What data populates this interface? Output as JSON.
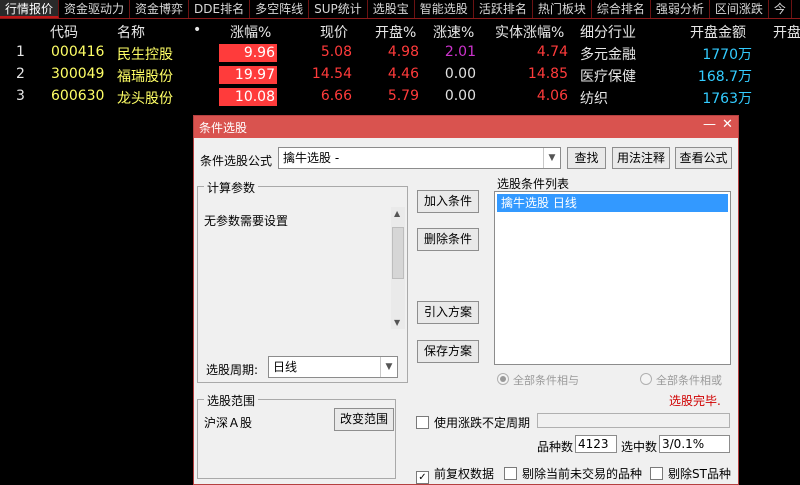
{
  "tabs": [
    "行情报价",
    "资金驱动力",
    "资金博弈",
    "DDE排名",
    "多空阵线",
    "SUP统计",
    "选股宝",
    "智能选股",
    "活跃排名",
    "热门板块",
    "综合排名",
    "强弱分析",
    "区间涨跌",
    "今"
  ],
  "table": {
    "headers": {
      "idx": "",
      "code": "代码",
      "name": "名称",
      "dot": "•",
      "pct": "涨幅%",
      "price": "现价",
      "open_pct": "开盘%",
      "speed": "涨速%",
      "body_pct": "实体涨幅%",
      "industry": "细分行业",
      "open_amt": "开盘金额",
      "open_more": "开盘"
    },
    "rows": [
      {
        "idx": "1",
        "code": "000416",
        "name": "民生控股",
        "pct": "9.96",
        "price": "5.08",
        "open_pct": "4.98",
        "speed": "2.01",
        "body_pct": "4.74",
        "industry": "多元金融",
        "open_amt": "1770万"
      },
      {
        "idx": "2",
        "code": "300049",
        "name": "福瑞股份",
        "pct": "19.97",
        "price": "14.54",
        "open_pct": "4.46",
        "speed": "0.00",
        "body_pct": "14.85",
        "industry": "医疗保健",
        "open_amt": "168.7万"
      },
      {
        "idx": "3",
        "code": "600630",
        "name": "龙头股份",
        "pct": "10.08",
        "price": "6.66",
        "open_pct": "5.79",
        "speed": "0.00",
        "body_pct": "4.06",
        "industry": "纺织",
        "open_amt": "1763万"
      }
    ]
  },
  "colors": {
    "up": "#ff3b3b",
    "code": "#ffff66",
    "speed_up": "#cc33cc",
    "speed_flat": "#e0e0e0",
    "open_amt": "#33ccff",
    "accent": "#d9534f"
  },
  "dialog": {
    "title": "条件选股",
    "min_icon": "—",
    "close_icon": "✕",
    "formula_label": "条件选股公式",
    "formula_value": "擒牛选股     -",
    "btn_find": "查找",
    "btn_usage": "用法注释",
    "btn_view": "查看公式",
    "params_title": "计算参数",
    "params_text": "无参数需要设置",
    "period_label": "选股周期:",
    "period_value": "日线",
    "btn_add": "加入条件",
    "btn_delete": "删除条件",
    "btn_import": "引入方案",
    "btn_save": "保存方案",
    "list_title": "选股条件列表",
    "list_items": [
      "擒牛选股  日线"
    ],
    "radio_and": "全部条件相与",
    "radio_or": "全部条件相或",
    "status": "选股完毕.",
    "range_title": "选股范围",
    "range_value": "沪深Ａ股",
    "btn_change_range": "改变范围",
    "use_period_label": "使用涨跌不定周期",
    "count_label": "品种数",
    "count_value": "4123",
    "selected_label": "选中数",
    "selected_value": "3/0.1%",
    "chk_adjusted": "前复权数据",
    "chk_adjusted_checked": "✓",
    "chk_no_trade": "剔除当前未交易的品种",
    "chk_st": "剔除ST品种"
  }
}
